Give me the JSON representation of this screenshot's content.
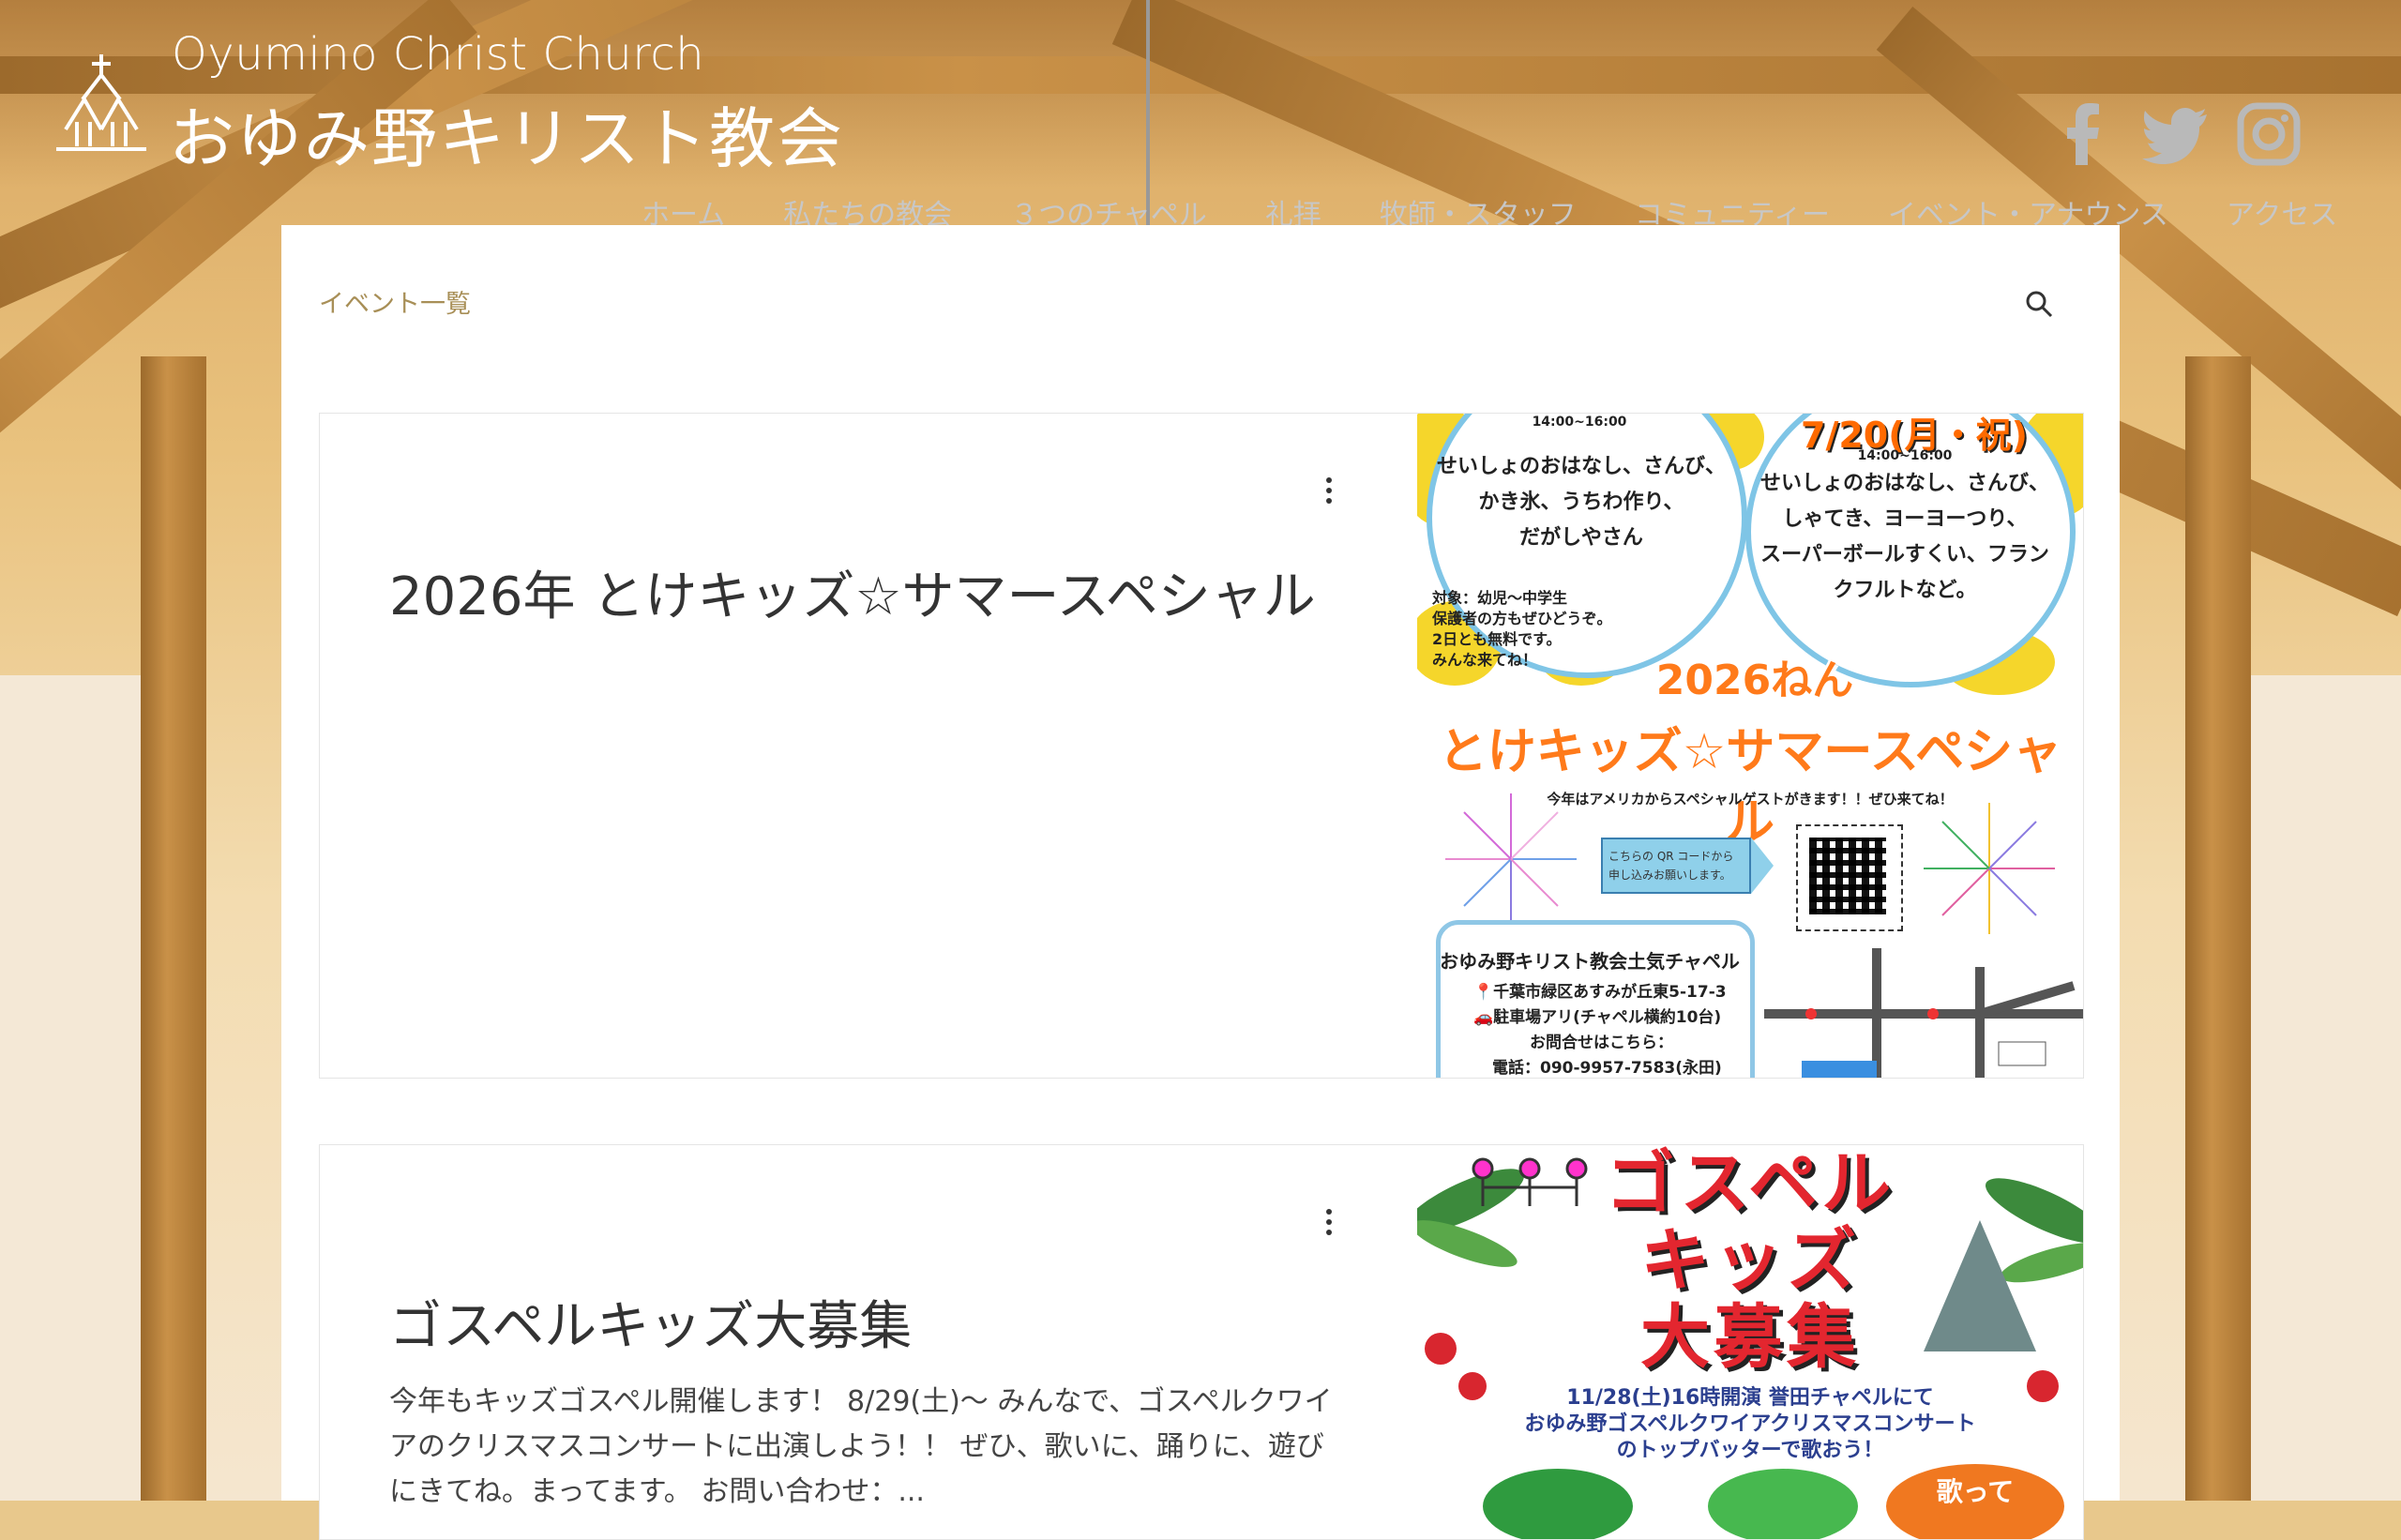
{
  "header": {
    "brand_en": "Oyumino Christ Church",
    "brand_ja": "おゆみ野キリスト教会"
  },
  "social": [
    "facebook-icon",
    "twitter-icon",
    "instagram-icon"
  ],
  "nav": [
    "ホーム",
    "私たちの教会",
    "３つのチャペル",
    "礼拝",
    "牧師・スタッフ",
    "コミュニティー",
    "イベント・アナウンス",
    "アクセス"
  ],
  "page": {
    "breadcrumb": "イベント一覧"
  },
  "posts": [
    {
      "title": "2026年 とけキッズ☆サマースペシャル",
      "excerpt": "",
      "image": {
        "left_circle": [
          "せいしょのおはなし、さんび、",
          "かき氷、うちわ作り、",
          "だがしやさん"
        ],
        "left_time": "14:00~16:00",
        "right_date": "7/20(月・祝)",
        "right_time": "14:00~16:00",
        "right_circle": [
          "せいしょのおはなし、さんび、",
          "しゃてき、ヨーヨーつり、",
          "スーパーボールすくい、フラン",
          "クフルトなど。"
        ],
        "target_note": [
          "対象：幼児〜中学生",
          "保護者の方もぜひどうぞ。",
          "2日とも無料です。",
          "みんな来てね！"
        ],
        "year_title": "2026ねん",
        "main_title": "とけキッズ☆サマースペシャル",
        "guest_note": "今年はアメリカからスペシャルゲストがきます！！ぜひ来てね！",
        "qr_note": [
          "こちらの QR コードから",
          "申し込みお願いします。"
        ],
        "venue": "おゆみ野キリスト教会土気チャペル",
        "address": "📍千葉市緑区あすみが丘東5-17-3",
        "parking": "🚗駐車場アリ(チャペル横約10台)",
        "contact": "お問合せはこちら：",
        "phone": "電話：090-9957-7583(永田)"
      }
    },
    {
      "title": "ゴスペルキッズ大募集",
      "excerpt": "今年もキッズゴスペル開催します！ 8/29(土)〜 みんなで、ゴスペルクワイアのクリスマスコンサートに出演しよう！！ ぜひ、歌いに、踊りに、遊びにきてね。まってます。 お問い合わせ：...",
      "image": {
        "title_lines": [
          "ゴスペル",
          "キッズ",
          "大募集"
        ],
        "sub": [
          "11/28(土)16時開演 誉田チャペルにて",
          "おゆみ野ゴスペルクワイアクリスマスコンサート",
          "のトップバッターで歌おう！"
        ],
        "badge": "歌って"
      }
    }
  ],
  "colors": {
    "accent": "#a88f57",
    "nav_text": "#c7c7c7",
    "card_bg": "#ffffff",
    "flyer_orange": "#ff7a1a",
    "flyer_red": "#e3262f",
    "flyer_blue": "#7fc5e6"
  }
}
